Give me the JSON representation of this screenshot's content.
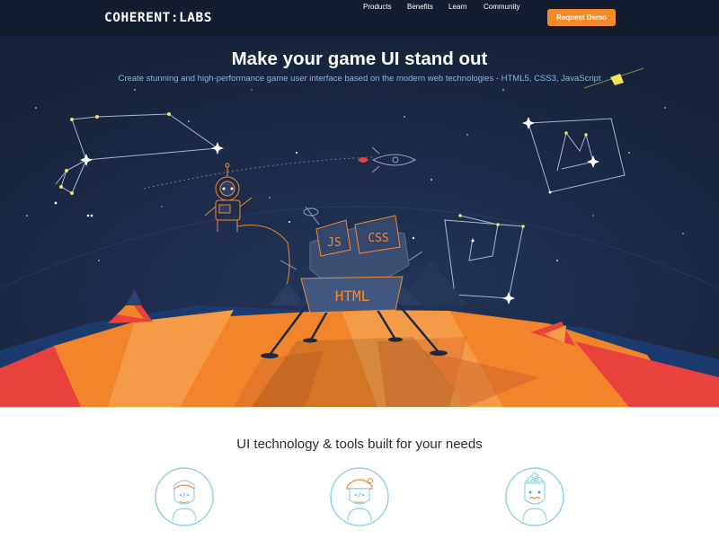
{
  "header": {
    "logo": "COHERENT:LABS",
    "nav": [
      {
        "label": "Products"
      },
      {
        "label": "Benefits"
      },
      {
        "label": "Learn"
      },
      {
        "label": "Community"
      }
    ],
    "cta_label": "Request Demo"
  },
  "hero": {
    "title": "Make your game UI stand out",
    "subtitle": "Create stunning and high-performance game user interface based on the modern web technologies - HTML5, CSS3, JavaScript",
    "lander_labels": {
      "js": "JS",
      "css": "CSS",
      "html": "HTML"
    }
  },
  "features": {
    "title": "UI technology & tools built for your needs",
    "icons": [
      {
        "icon": "developer-avatar-icon"
      },
      {
        "icon": "designer-avatar-icon"
      },
      {
        "icon": "artist-avatar-icon"
      }
    ],
    "icon_code_glyph": "</>",
    "icon_ab_glyph": "AB"
  },
  "colors": {
    "header_bg": "#141d2f",
    "hero_bg": "#1b2a45",
    "accent_orange": "#f28a2c",
    "subtitle_blue": "#7dbbe2",
    "planet_orange": "#f2842b",
    "planet_red": "#e8423f",
    "icon_teal": "#8fd3e6"
  }
}
